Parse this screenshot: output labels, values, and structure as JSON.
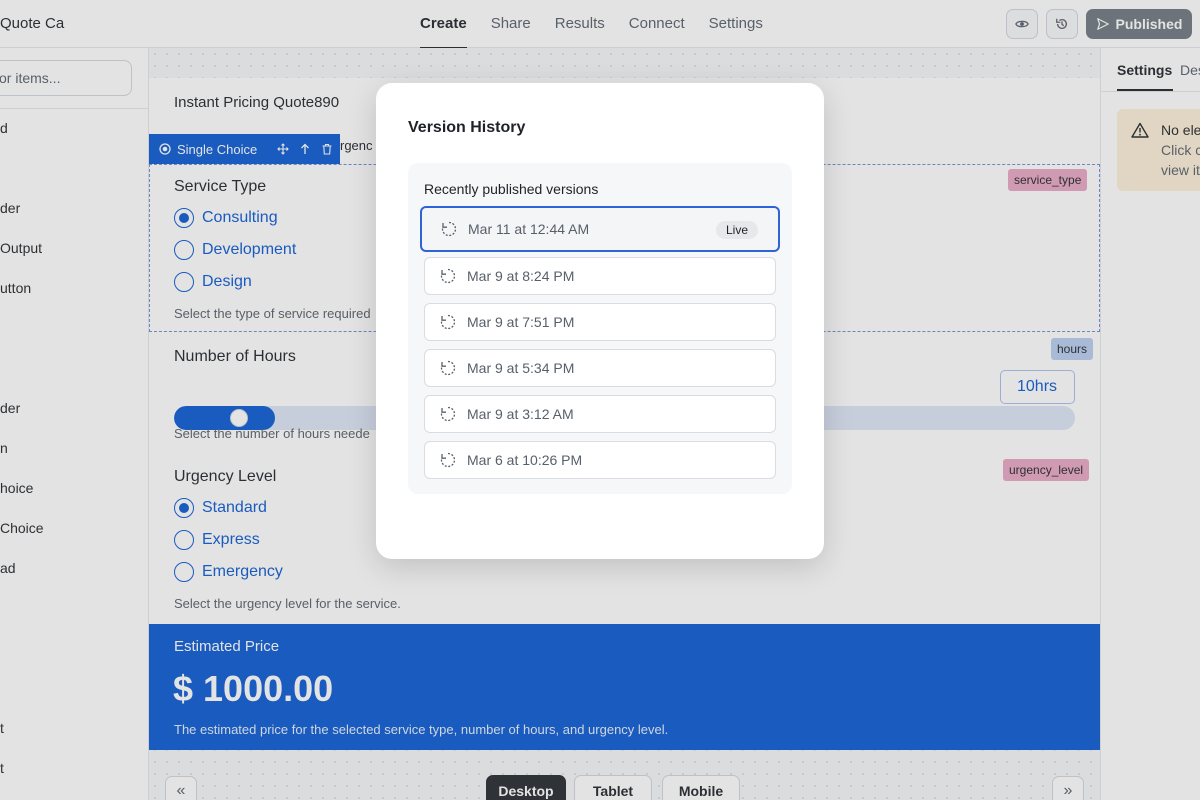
{
  "header": {
    "app_title": "Quote Ca",
    "tabs": [
      "Create",
      "Share",
      "Results",
      "Connect",
      "Settings"
    ],
    "active_tab": "Create",
    "publish_label": "Published"
  },
  "left_sidebar": {
    "search_placeholder": "or items...",
    "items": [
      "d",
      "der",
      "Output",
      "utton",
      "der",
      "n",
      "hoice",
      "Choice",
      "ad",
      "t",
      "t"
    ]
  },
  "form": {
    "title": "Instant Pricing Quote890",
    "toolbar_chip_label": "Single Choice",
    "toolbar_overflow_text": "rgenc",
    "service_type": {
      "label": "Service Type",
      "options": [
        "Consulting",
        "Development",
        "Design"
      ],
      "selected": "Consulting",
      "helper": "Select the type of service required",
      "variable": "service_type"
    },
    "hours": {
      "label": "Number of Hours",
      "value_display": "10hrs",
      "slider_fraction": 0.1,
      "helper": "Select the number of hours neede",
      "variable": "hours"
    },
    "urgency": {
      "label": "Urgency Level",
      "options": [
        "Standard",
        "Express",
        "Emergency"
      ],
      "selected": "Standard",
      "helper": "Select the urgency level for the service.",
      "variable": "urgency_level"
    },
    "price": {
      "label": "Estimated Price",
      "value": "$ 1000.00",
      "description": "The estimated price for the selected service type, number of hours, and urgency level."
    }
  },
  "bottom_bar": {
    "devices": [
      "Desktop",
      "Tablet",
      "Mobile"
    ],
    "active_device": "Desktop",
    "prev_label": "«",
    "next_label": "»"
  },
  "right_panel": {
    "tabs": [
      "Settings",
      "Des"
    ],
    "active_tab": "Settings",
    "notice_title": "No ele",
    "notice_lines": [
      "Click c",
      "view it"
    ]
  },
  "modal": {
    "title": "Version History",
    "section_heading": "Recently published versions",
    "versions": [
      {
        "label": "Mar 11 at 12:44 AM",
        "badge": "Live"
      },
      {
        "label": "Mar 9 at 8:24 PM"
      },
      {
        "label": "Mar 9 at 7:51 PM"
      },
      {
        "label": "Mar 9 at 5:34 PM"
      },
      {
        "label": "Mar 9 at 3:12 AM"
      },
      {
        "label": "Mar 6 at 10:26 PM"
      }
    ]
  },
  "colors": {
    "accent": "#0a5ad4",
    "tag_pink": "#e8a7c4",
    "tag_blue": "#b9cdf0",
    "selected_border": "#2f63d8"
  },
  "icons": {
    "preview": "eye-icon",
    "history": "history-icon",
    "publish": "send-icon",
    "version": "restore-icon",
    "warning": "warning-icon"
  }
}
